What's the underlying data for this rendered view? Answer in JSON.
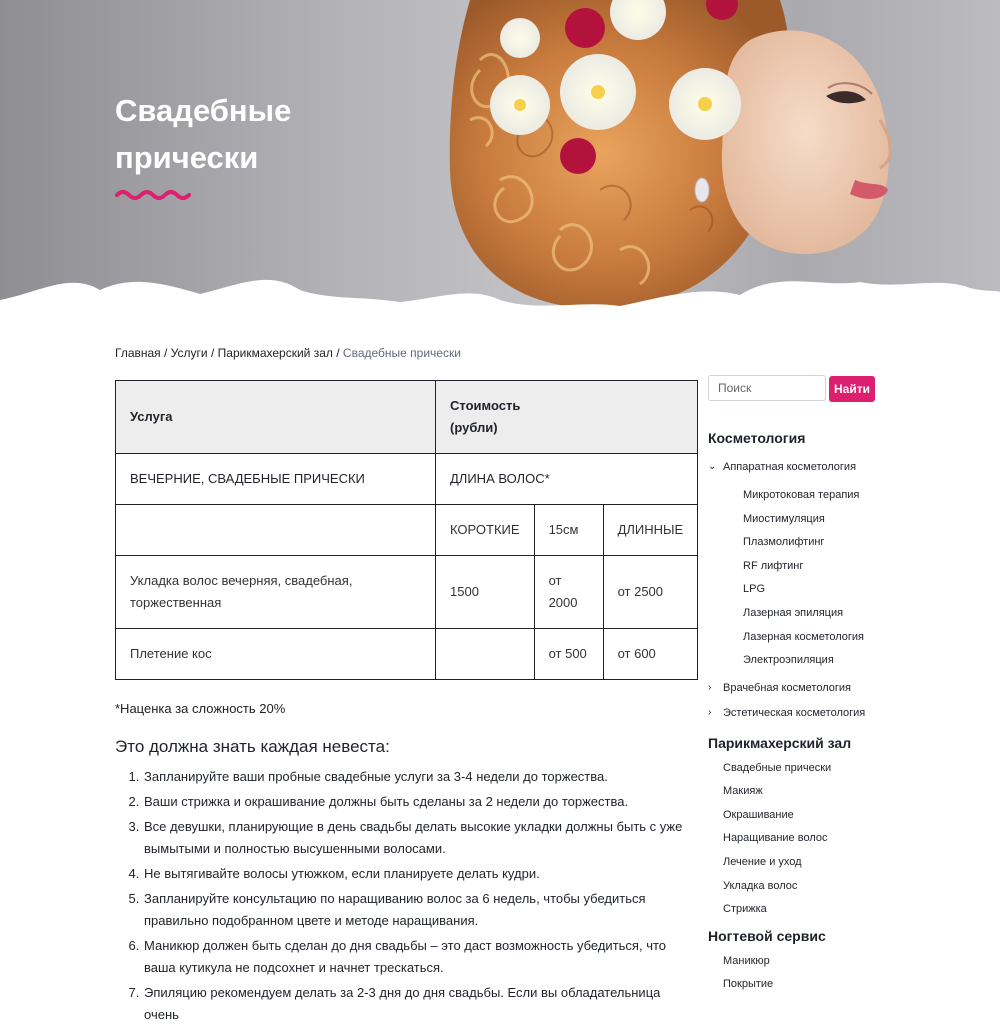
{
  "hero": {
    "title_line1": "Свадебные",
    "title_line2": "прически",
    "accent_color": "#dc1f6e"
  },
  "breadcrumb": {
    "home": "Главная",
    "services": "Услуги",
    "hair_salon": "Парикмахерский зал",
    "current": "Свадебные прически",
    "separator": "/"
  },
  "price_table": {
    "header": {
      "service": "Услуга",
      "cost_line1": "Стоимость",
      "cost_line2": "(рубли)"
    },
    "row1": {
      "service": "ВЕЧЕРНИЕ, СВАДЕБНЫЕ ПРИЧЕСКИ",
      "hair_length": "ДЛИНА ВОЛОС*"
    },
    "row2": {
      "service": "",
      "short": "КОРОТКИЕ",
      "medium": "15см",
      "long": "ДЛИННЫЕ"
    },
    "row3": {
      "service_line1": "Укладка волос вечерняя, свадебная,",
      "service_line2": "торжественная",
      "short": "1500",
      "medium_line1": "от",
      "medium_line2": "2000",
      "long": "от 2500"
    },
    "row4": {
      "service": "Плетение кос",
      "short": "",
      "medium": "от 500",
      "long": "от 600"
    }
  },
  "note": "*Наценка за сложность 20%",
  "bride_section": {
    "title": "Это должна знать каждая невеста:",
    "tips": [
      "Запланируйте ваши пробные свадебные услуги за 3-4 недели до торжества.",
      "Ваши стрижка и окрашивание должны быть сделаны за 2 недели до торжества.",
      "Все девушки, планирующие в день свадьбы делать высокие укладки должны быть с уже вымытыми и полностью высушенными волосами.",
      "Не вытягивайте волосы утюжком, если планируете делать кудри.",
      "Запланируйте консультацию по наращиванию волос за 6 недель, чтобы убедиться правильно подобранном цвете и методе наращивания.",
      "Маникюр должен быть сделан до дня свадьбы – это даст возможность убедиться, что ваша кутикула не подсохнет и начнет трескаться.",
      "Эпиляцию рекомендуем делать за 2-3 дня до дня свадьбы. Если вы обладательница очень"
    ]
  },
  "sidebar": {
    "search_placeholder": "Поиск",
    "search_button": "Найти",
    "cosmetology": {
      "heading": "Косметология",
      "hardware": {
        "label": "Аппаратная косметология",
        "items": [
          "Микротоковая терапия",
          "Миостимуляция",
          "Плазмолифтинг",
          "RF лифтинг",
          "LPG",
          "Лазерная эпиляция",
          "Лазерная косметология",
          "Электроэпиляция"
        ]
      },
      "medical": "Врачебная косметология",
      "aesthetic": "Эстетическая косметология"
    },
    "hair_salon": {
      "heading": "Парикмахерский зал",
      "items": [
        "Свадебные прически",
        "Макияж",
        "Окрашивание",
        "Наращивание волос",
        "Лечение и уход",
        "Укладка волос",
        "Стрижка"
      ]
    },
    "nail_service": {
      "heading": "Ногтевой сервис",
      "items": [
        "Маникюр",
        "Покрытие"
      ]
    }
  }
}
